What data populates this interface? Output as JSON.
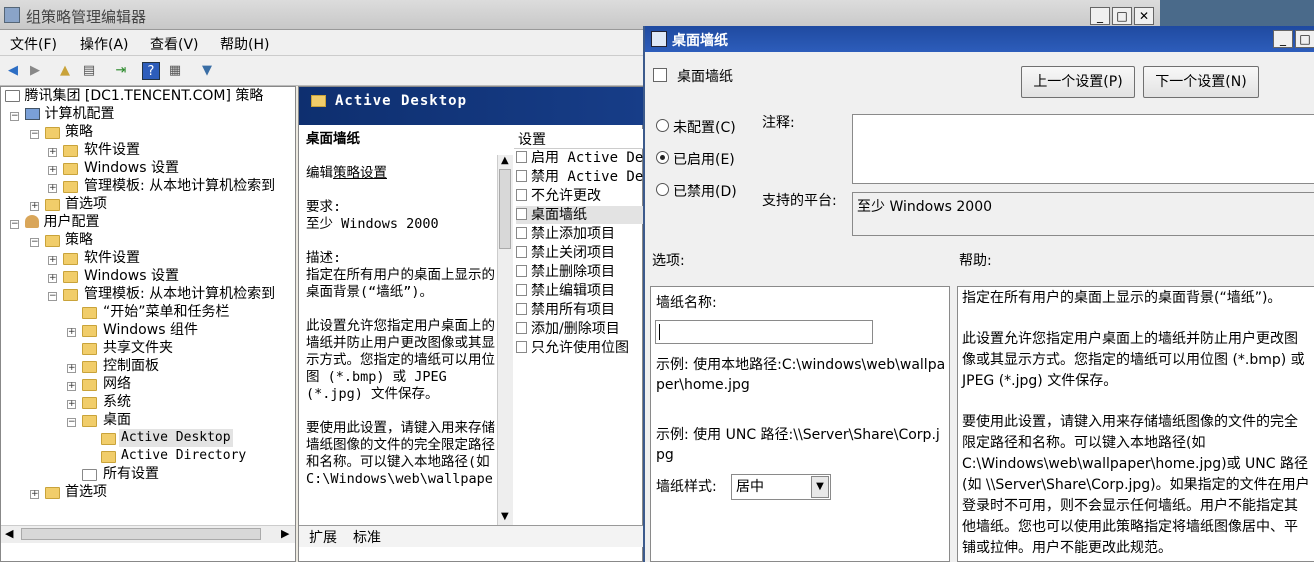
{
  "main": {
    "title": "组策略管理编辑器",
    "win_min": "_",
    "win_max": "□",
    "win_close": "✕",
    "menu": [
      "文件(F)",
      "操作(A)",
      "查看(V)",
      "帮助(H)"
    ]
  },
  "tree": {
    "root": "腾讯集团 [DC1.TENCENT.COM] 策略",
    "computer_config": "计算机配置",
    "c_policies": "策略",
    "c_software": "软件设置",
    "c_windows": "Windows 设置",
    "c_admin": "管理模板: 从本地计算机检索到",
    "c_prefs": "首选项",
    "user_config": "用户配置",
    "u_policies": "策略",
    "u_software": "软件设置",
    "u_windows": "Windows 设置",
    "u_admin": "管理模板: 从本地计算机检索到",
    "start_menu": "“开始”菜单和任务栏",
    "win_components": "Windows 组件",
    "shared_folders": "共享文件夹",
    "control_panel": "控制面板",
    "network": "网络",
    "system": "系统",
    "desktop": "桌面",
    "active_desktop": "Active Desktop",
    "active_directory": "Active Directory",
    "all_settings": "所有设置",
    "u_prefs": "首选项"
  },
  "middle": {
    "header": "Active Desktop",
    "policy_title": "桌面墙纸",
    "edit_prefix": "编辑",
    "edit_link": "策略设置",
    "requirement_label": "要求:",
    "requirement": "至少 Windows 2000",
    "description_label": "描述:",
    "description": "指定在所有用户的桌面上显示的桌面背景(“墙纸”)。",
    "para2": "此设置允许您指定用户桌面上的墙纸并防止用户更改图像或其显示方式。您指定的墙纸可以用位图 (*.bmp) 或 JPEG (*.jpg) 文件保存。",
    "para3": "要使用此设置，请键入用来存储墙纸图像的文件的完全限定路径和名称。可以键入本地路径(如 C:\\Windows\\web\\wallpape",
    "list_header": "设置",
    "list": [
      "启用 Active De",
      "禁用 Active De",
      "不允许更改",
      "桌面墙纸",
      "禁止添加项目",
      "禁止关闭项目",
      "禁止删除项目",
      "禁止编辑项目",
      "禁用所有项目",
      "添加/删除项目",
      "只允许使用位图"
    ],
    "tab_extended": "扩展",
    "tab_standard": "标准"
  },
  "dialog": {
    "title": "桌面墙纸",
    "setting_name": "桌面墙纸",
    "prev_button": "上一个设置(P)",
    "next_button": "下一个设置(N)",
    "not_configured": "未配置(C)",
    "enabled": "已启用(E)",
    "disabled": "已禁用(D)",
    "comment_label": "注释:",
    "platform_label": "支持的平台:",
    "platform_value": "至少 Windows 2000",
    "options_label": "选项:",
    "help_label": "帮助:",
    "wallpaper_name_label": "墙纸名称:",
    "wallpaper_name_value": "",
    "example_local": "示例: 使用本地路径:C:\\windows\\web\\wallpaper\\home.jpg",
    "example_unc": "示例: 使用 UNC 路径:\\\\Server\\Share\\Corp.jpg",
    "style_label": "墙纸样式:",
    "style_value": "居中",
    "help_p1": "指定在所有用户的桌面上显示的桌面背景(“墙纸”)。",
    "help_p2": "此设置允许您指定用户桌面上的墙纸并防止用户更改图像或其显示方式。您指定的墙纸可以用位图 (*.bmp) 或 JPEG (*.jpg) 文件保存。",
    "help_p3": "要使用此设置，请键入用来存储墙纸图像的文件的完全限定路径和名称。可以键入本地路径(如 C:\\Windows\\web\\wallpaper\\home.jpg)或 UNC 路径(如 \\\\Server\\Share\\Corp.jpg)。如果指定的文件在用户登录时不可用，则不会显示任何墙纸。用户不能指定其他墙纸。您也可以使用此策略指定将墙纸图像居中、平铺或拉伸。用户不能更改此规范。"
  },
  "colors": {
    "title_bar_active": "#1f4aa0",
    "selected_highlight": "#e3e3e3",
    "header_blue": "#0e2f6f"
  }
}
